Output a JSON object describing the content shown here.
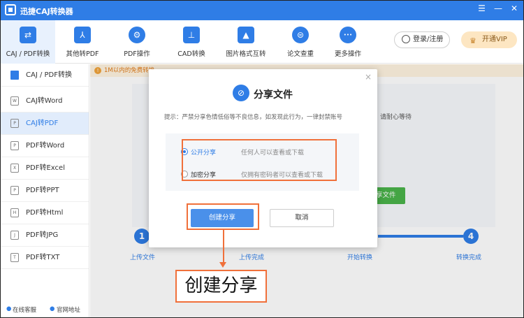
{
  "app": {
    "title": "迅捷CAJ转换器",
    "window_controls": [
      "☰",
      "—",
      "✕"
    ]
  },
  "toolbar": {
    "tools": [
      {
        "label": "CAJ / PDF转换",
        "icon": "swap-icon",
        "glyph": "⇄"
      },
      {
        "label": "其他转PDF",
        "icon": "pdf-icon",
        "glyph": "⅄"
      },
      {
        "label": "PDF操作",
        "icon": "gear-icon",
        "glyph": "⚙"
      },
      {
        "label": "CAD转换",
        "icon": "cad-icon",
        "glyph": "⊥"
      },
      {
        "label": "图片格式互转",
        "icon": "image-icon",
        "glyph": "▲"
      },
      {
        "label": "论文查重",
        "icon": "search-icon",
        "glyph": "⊜"
      },
      {
        "label": "更多操作",
        "icon": "more-icon",
        "glyph": "•••"
      }
    ],
    "login_label": "登录/注册",
    "vip_label": "开通VIP",
    "vip_glyph": "♛"
  },
  "sidebar": {
    "items": [
      {
        "label": "CAJ / PDF转换",
        "tag": ""
      },
      {
        "label": "CAJ转Word",
        "tag": "W"
      },
      {
        "label": "CAJ转PDF",
        "tag": "P"
      },
      {
        "label": "PDF转Word",
        "tag": "P"
      },
      {
        "label": "PDF转Excel",
        "tag": "X"
      },
      {
        "label": "PDF转PPT",
        "tag": "P"
      },
      {
        "label": "PDF转Html",
        "tag": "H"
      },
      {
        "label": "PDF转JPG",
        "tag": "J"
      },
      {
        "label": "PDF转TXT",
        "tag": "T"
      }
    ],
    "footer": {
      "service": "在线客服",
      "website": "官网地址"
    }
  },
  "main": {
    "notice_icon": "!",
    "notice": "1M以内的免费转换",
    "behind_text": "请耐心等待",
    "green_button": "享文件",
    "steps": [
      {
        "number": "1",
        "label": "上传文件"
      },
      {
        "number": "",
        "label": "上传完成"
      },
      {
        "number": "",
        "label": "开始转换"
      },
      {
        "number": "4",
        "label": "转换完成"
      }
    ]
  },
  "dialog": {
    "icon": "link-icon",
    "icon_glyph": "⊘",
    "title": "分享文件",
    "close": "×",
    "hint": "提示：严禁分享色情低俗等不良信息，如发现此行为，一律封禁账号",
    "options": [
      {
        "label": "公开分享",
        "desc": "任何人可以查看或下载",
        "selected": true
      },
      {
        "label": "加密分享",
        "desc": "仅拥有密码者可以查看或下载",
        "selected": false
      }
    ],
    "create_label": "创建分享",
    "cancel_label": "取消"
  },
  "annotation": {
    "callout": "创建分享",
    "color": "#f0703a"
  },
  "colors": {
    "accent": "#2f7de6",
    "highlight": "#f0703a",
    "green": "#4ab34a"
  }
}
